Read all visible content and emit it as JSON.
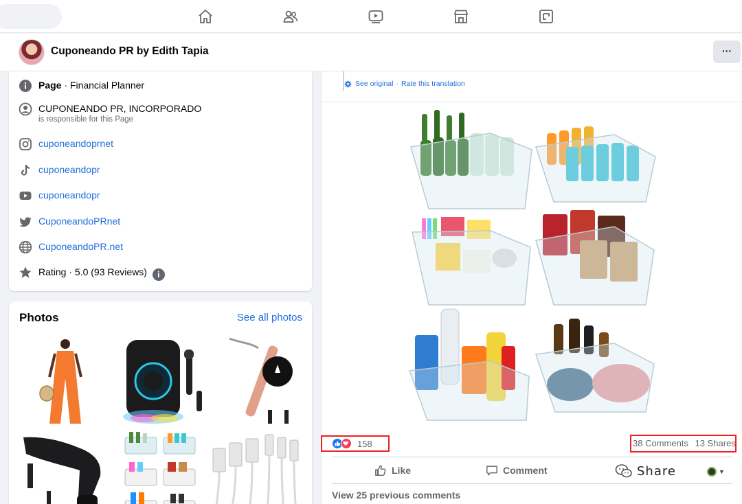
{
  "header": {
    "page_name": "Cuponeando PR by Edith Tapia",
    "more_label": "···"
  },
  "nav": {
    "icons": [
      "home-icon",
      "friends-icon",
      "watch-icon",
      "marketplace-icon",
      "gaming-icon"
    ]
  },
  "intro": {
    "category_label": "Page",
    "category_value": "· Financial Planner",
    "org_name": "CUPONEANDO PR, INCORPORADO",
    "org_sub": "is responsible for this Page",
    "instagram": "cuponeandoprnet",
    "tiktok": "cuponeandopr",
    "youtube": "cuponeandopr",
    "twitter": "CuponeandoPRnet",
    "website": "CuponeandoPR.net",
    "rating": "Rating · 5.0 (93 Reviews)",
    "rating_info": "i"
  },
  "photos": {
    "title": "Photos",
    "see_all": "See all photos"
  },
  "post": {
    "see_original": "See original",
    "separator": "·",
    "rate_translation": "Rate this translation",
    "reaction_count": "158",
    "comments": "38 Comments",
    "shares": "13 Shares",
    "like_label": "Like",
    "comment_label": "Comment",
    "share_label": "Share",
    "view_previous": "View 25 previous comments"
  },
  "colors": {
    "accent": "#216fdb",
    "like_blue": "#1877f2",
    "love_red": "#f33e58",
    "highlight_red": "#ee2222"
  }
}
